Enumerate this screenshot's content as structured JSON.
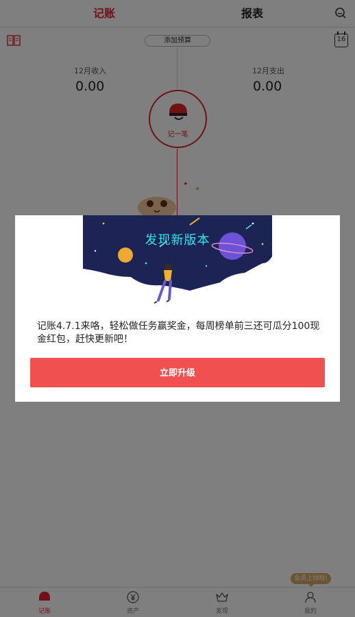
{
  "header": {
    "tabs": [
      {
        "label": "记账"
      },
      {
        "label": "报表"
      }
    ]
  },
  "main": {
    "budget_label": "添加预算",
    "calendar_day": "16",
    "income": {
      "label": "12月收入",
      "value": "0.00"
    },
    "expense": {
      "label": "12月支出",
      "value": "0.00"
    },
    "record_label": "记一笔"
  },
  "dialog": {
    "banner_title": "发现新版本",
    "message": "记账4.7.1来咯，轻松做任务赢奖金，每周榜单前三还可瓜分100现金红包，赶快更新吧！",
    "upgrade_label": "立即升级"
  },
  "member_badge": "会员上线啦!",
  "tabbar": {
    "items": [
      {
        "label": "记账",
        "icon": "helmet-icon"
      },
      {
        "label": "资产",
        "icon": "yen-icon"
      },
      {
        "label": "发现",
        "icon": "crown-icon"
      },
      {
        "label": "我的",
        "icon": "person-icon"
      }
    ]
  },
  "colors": {
    "accent": "#e2232d",
    "button": "#f05050",
    "banner_bg": "#1b2454",
    "banner_title": "#34e4e8",
    "badge": "#d6a868"
  }
}
